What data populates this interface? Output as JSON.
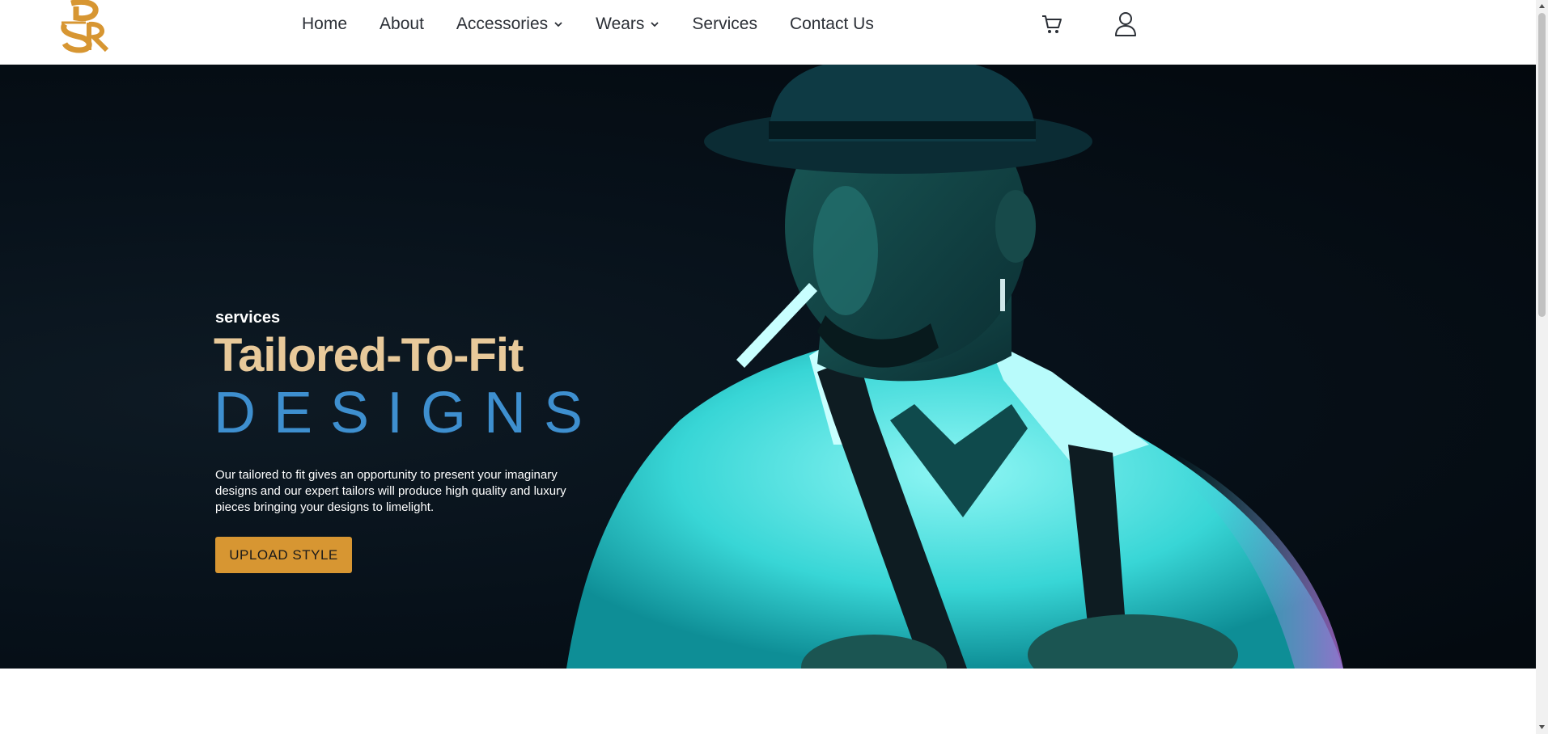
{
  "brand": {
    "logo_icon": "brand-monogram-logo",
    "accent": "#d79632"
  },
  "nav": {
    "items": [
      {
        "label": "Home"
      },
      {
        "label": "About"
      },
      {
        "label": "Accessories",
        "has_dropdown": true
      },
      {
        "label": "Wears",
        "has_dropdown": true
      },
      {
        "label": "Services"
      },
      {
        "label": "Contact Us"
      }
    ],
    "cart_icon": "cart-icon",
    "user_icon": "user-icon"
  },
  "hero": {
    "eyebrow": "services",
    "title": "Tailored-To-Fit",
    "subtitle": "DESIGNS",
    "description": "Our tailored to fit gives an opportunity to present your imaginary designs and our expert tailors will produce high quality and luxury pieces bringing your designs to limelight.",
    "cta_label": "UPLOAD STYLE",
    "colors": {
      "title": "#e8c99a",
      "subtitle": "#3e8fcf",
      "cta": "#d79632"
    }
  }
}
